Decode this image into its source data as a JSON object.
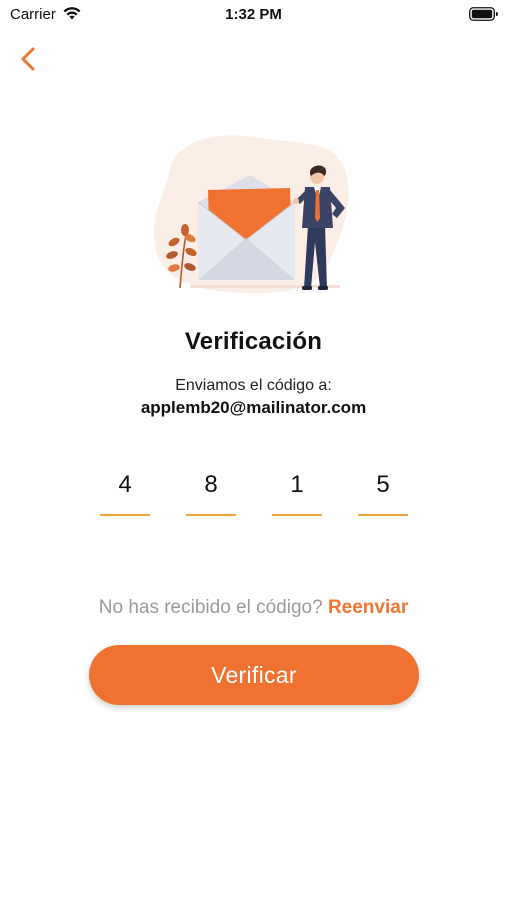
{
  "status_bar": {
    "carrier": "Carrier",
    "time": "1:32 PM",
    "wifi_icon": "wifi-icon",
    "battery_icon": "battery-icon"
  },
  "nav": {
    "back_icon": "chevron-left-icon"
  },
  "illustration": {
    "name": "envelope-illustration"
  },
  "verification": {
    "title": "Verificación",
    "subtitle": "Enviamos el código a:",
    "email": "applemb20@mailinator.com"
  },
  "code": {
    "digits": [
      "4",
      "8",
      "1",
      "5"
    ]
  },
  "resend": {
    "prompt": "No has recibido el código?",
    "link": "Reenviar"
  },
  "verify_button": {
    "label": "Verificar"
  },
  "colors": {
    "accent": "#f07230",
    "underline": "#f0a437",
    "muted_text": "#9a9a9a"
  }
}
